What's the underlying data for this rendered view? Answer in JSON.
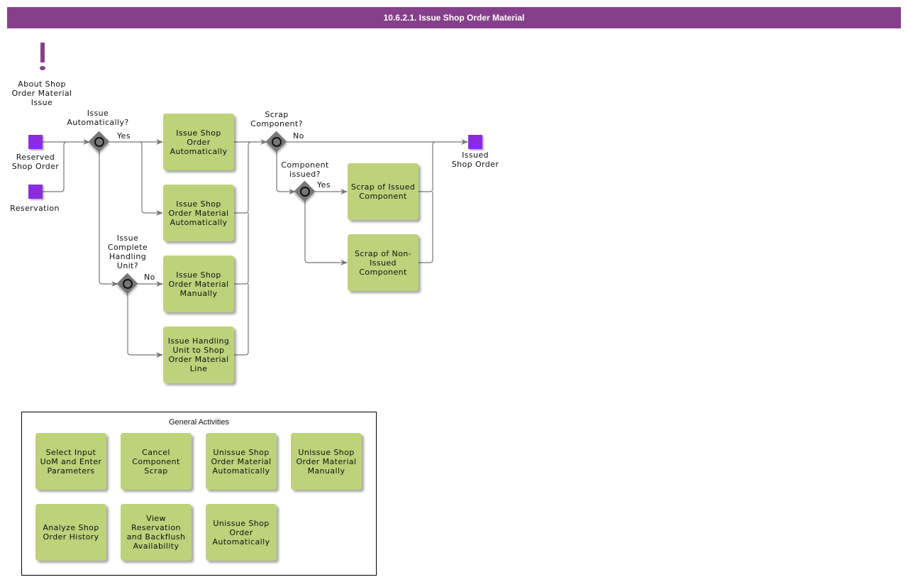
{
  "header": {
    "title": "10.6.2.1. Issue Shop Order Material",
    "color": "#86408b"
  },
  "colors": {
    "task": "#bdd27a",
    "event": "#8a2be2",
    "gateway": "#777777",
    "connector": "#777777"
  },
  "about": {
    "icon": "exclamation-icon",
    "label": "About Shop\nOrder Material\nIssue"
  },
  "events": {
    "reserved_shop_order": "Reserved\nShop Order",
    "reservation": "Reservation",
    "issued_shop_order": "Issued\nShop Order"
  },
  "gateways": {
    "issue_automatically": "Issue\nAutomatically?",
    "issue_complete_hu": "Issue\nComplete\nHandling\nUnit?",
    "scrap_component": "Scrap\nComponent?",
    "component_issued": "Component\nissued?"
  },
  "flow_labels": {
    "yes_auto": "Yes",
    "no_hu": "No",
    "no_scrap": "No",
    "yes_issued": "Yes"
  },
  "tasks": {
    "issue_so_auto": "Issue Shop Order Automatically",
    "issue_som_auto": "Issue Shop Order Material Automatically",
    "issue_som_manual": "Issue Shop Order Material Manually",
    "issue_hu": "Issue Handling Unit to Shop Order Material Line",
    "scrap_issued": "Scrap of Issued Component",
    "scrap_non_issued": "Scrap of Non-Issued Component"
  },
  "general_activities": {
    "title": "General Activities",
    "items": [
      "Select Input UoM and Enter Parameters",
      "Cancel Component Scrap",
      "Unissue Shop Order Material Automatically",
      "Unissue Shop Order Material Manually",
      "Analyze Shop Order History",
      "View Reservation and Backflush Availability",
      "Unissue Shop Order Automatically"
    ]
  }
}
